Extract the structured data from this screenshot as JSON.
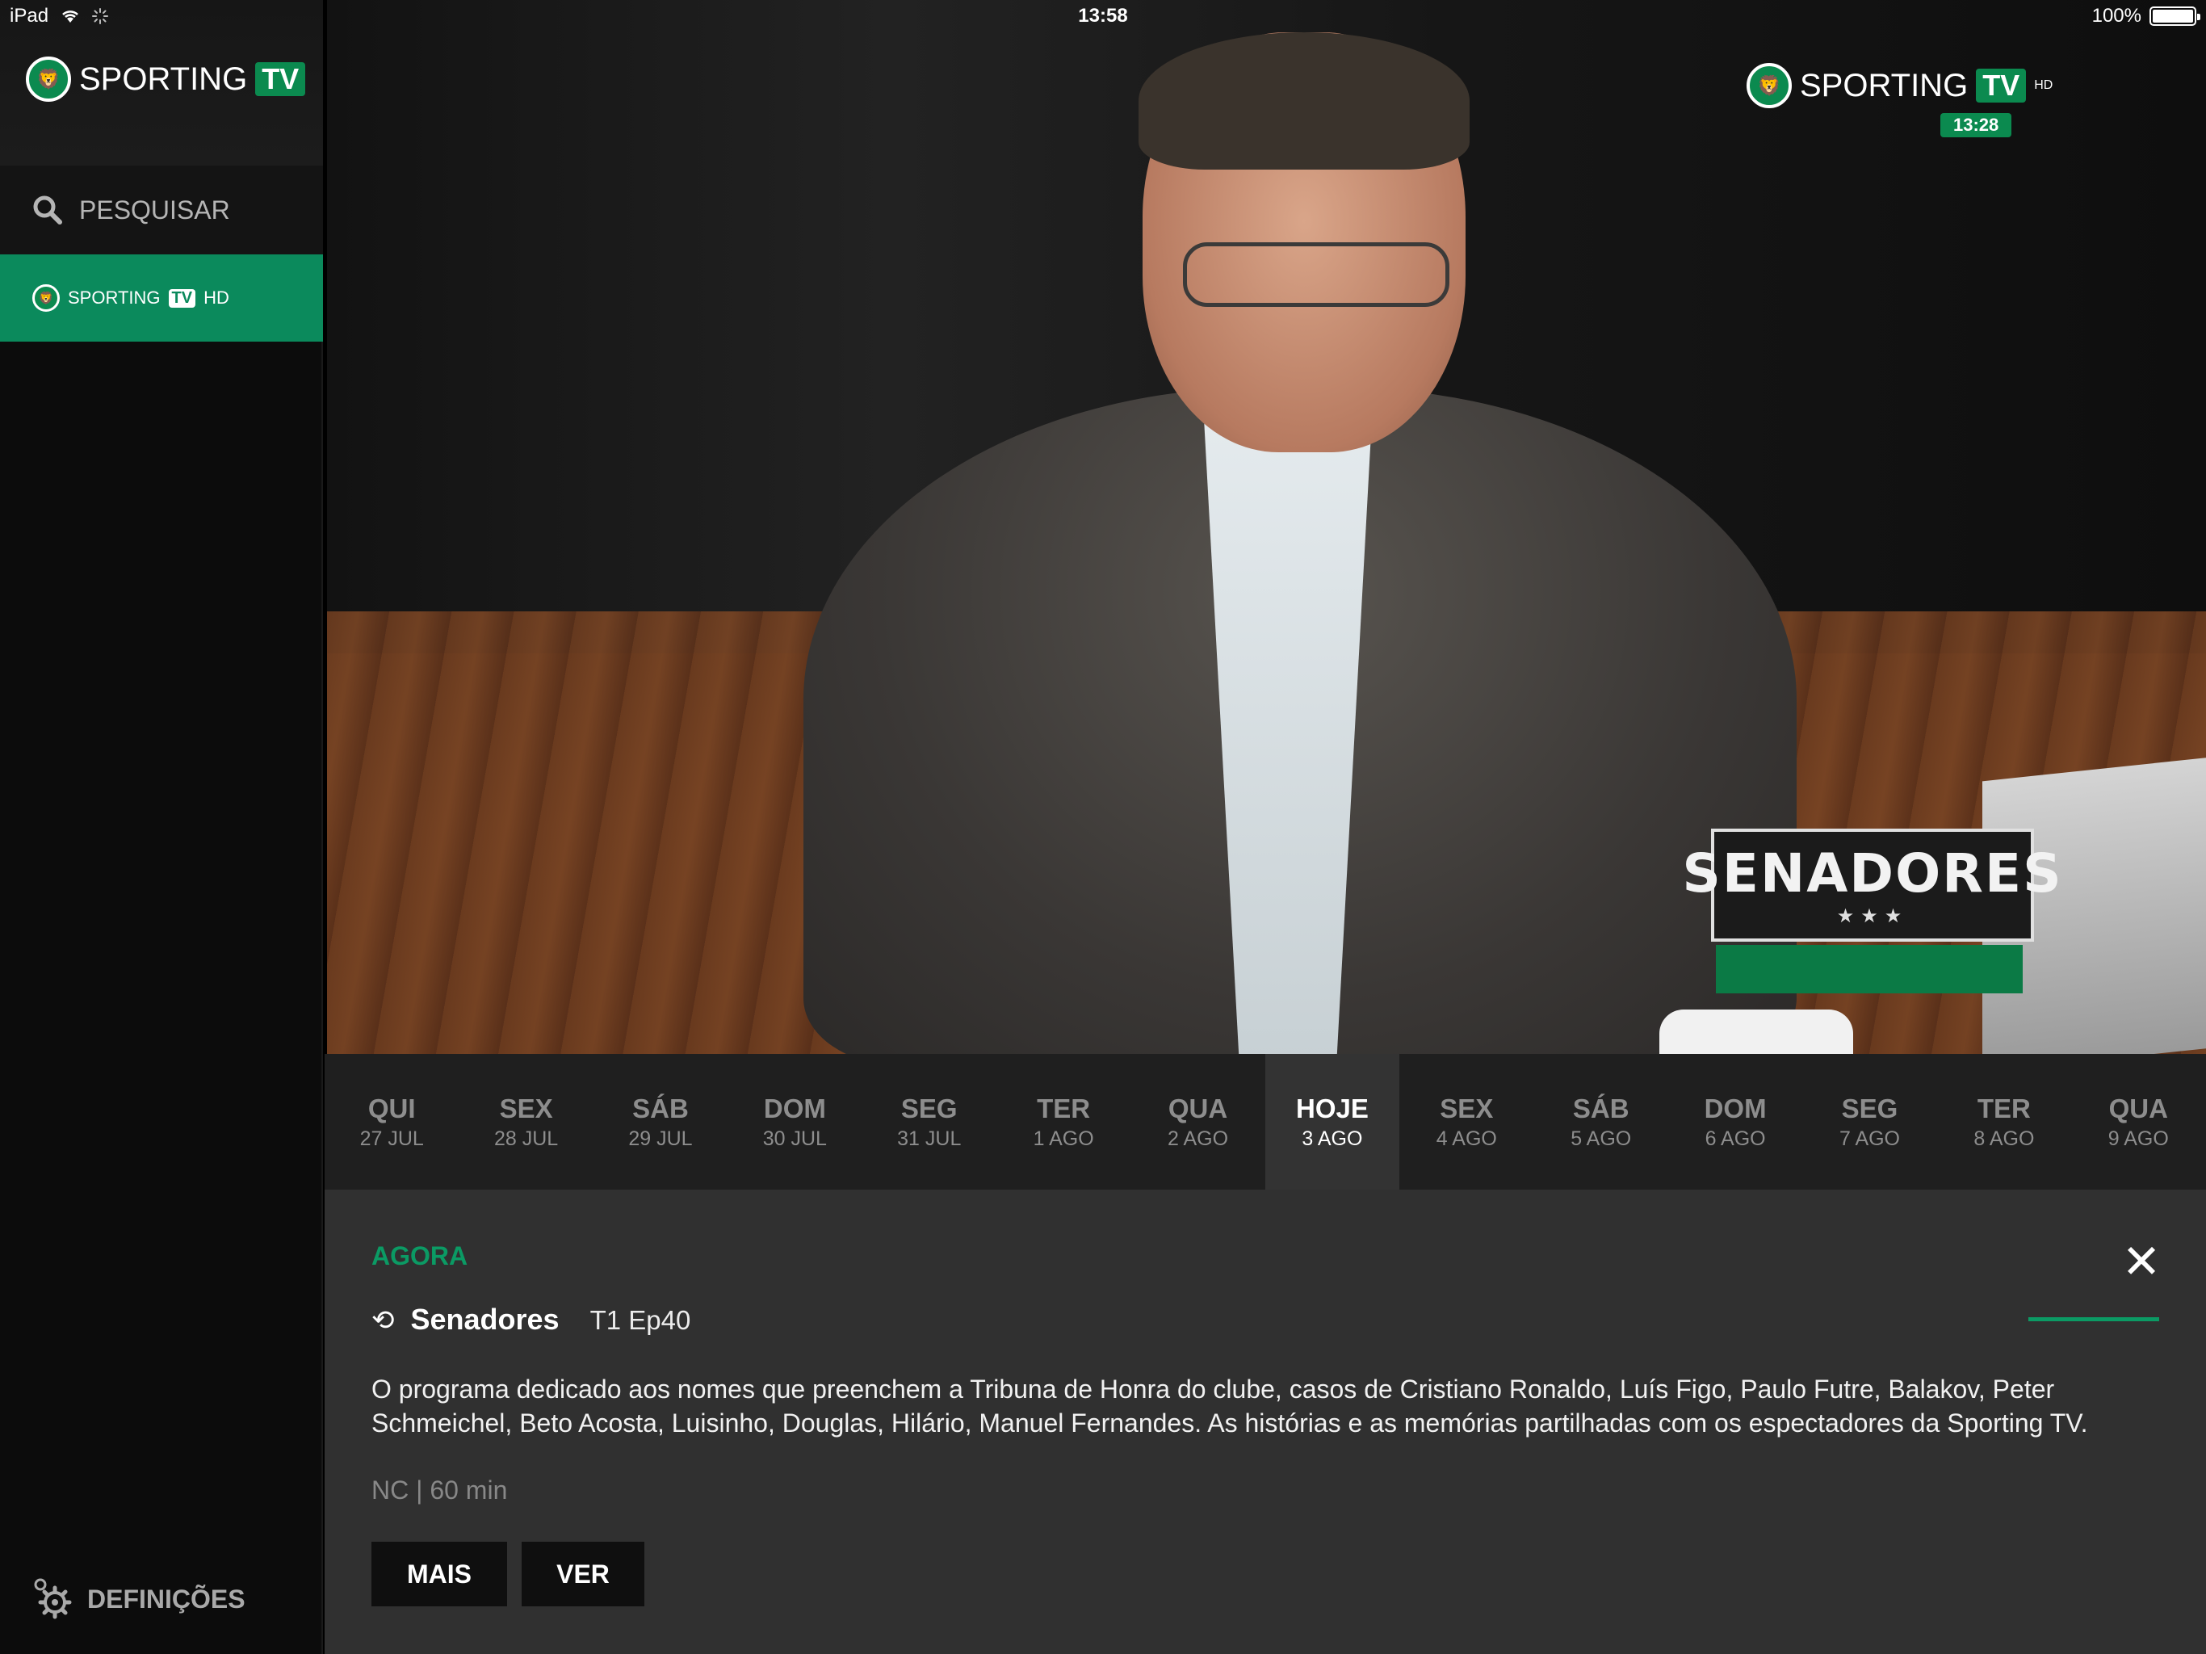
{
  "status_bar": {
    "device": "iPad",
    "time": "13:58",
    "battery": "100%",
    "battery_level": 1.0
  },
  "sidebar": {
    "brand_word": "SPORTING",
    "brand_tv": "TV",
    "search_label": "PESQUISAR",
    "channel": {
      "word": "SPORTING",
      "tv": "TV",
      "hd": "HD"
    },
    "settings_label": "DEFINIÇÕES"
  },
  "video": {
    "overlay_brand_word": "SPORTING",
    "overlay_brand_tv": "TV",
    "overlay_hd": "HD",
    "overlay_time": "13:28",
    "show_badge": "SENADORES",
    "show_badge_stars": "★★★"
  },
  "dates": [
    {
      "day": "QUI",
      "date": "27 JUL"
    },
    {
      "day": "SEX",
      "date": "28 JUL"
    },
    {
      "day": "SÁB",
      "date": "29 JUL"
    },
    {
      "day": "DOM",
      "date": "30 JUL"
    },
    {
      "day": "SEG",
      "date": "31 JUL"
    },
    {
      "day": "TER",
      "date": "1 AGO"
    },
    {
      "day": "QUA",
      "date": "2 AGO"
    },
    {
      "day": "HOJE",
      "date": "3 AGO"
    },
    {
      "day": "SEX",
      "date": "4 AGO"
    },
    {
      "day": "SÁB",
      "date": "5 AGO"
    },
    {
      "day": "DOM",
      "date": "6 AGO"
    },
    {
      "day": "SEG",
      "date": "7 AGO"
    },
    {
      "day": "TER",
      "date": "8 AGO"
    },
    {
      "day": "QUA",
      "date": "9 AGO"
    }
  ],
  "active_date_index": 7,
  "program": {
    "section_label": "AGORA",
    "title": "Senadores",
    "episode": "T1 Ep40",
    "description": "O programa dedicado aos nomes que preenchem a Tribuna de Honra do clube, casos de Cristiano Ronaldo, Luís Figo, Paulo Futre, Balakov, Peter Schmeichel, Beto Acosta, Luisinho, Douglas, Hilário, Manuel Fernandes. As histórias e as memórias partilhadas com os espectadores da Sporting TV.",
    "meta": "NC | 60 min",
    "more_label": "MAIS",
    "watch_label": "VER",
    "close_glyph": "✕"
  },
  "colors": {
    "accent_green": "#0b8a5c",
    "panel_bg": "#303030",
    "strip_bg": "#1f1f1f"
  }
}
